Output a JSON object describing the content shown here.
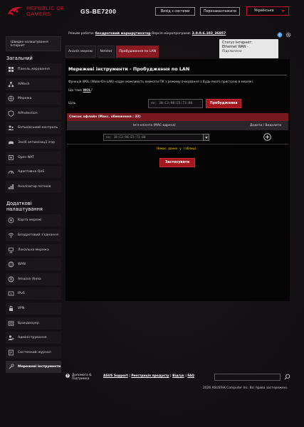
{
  "header": {
    "brand_line1": "REPUBLIC OF",
    "brand_line2": "GAMERS",
    "model": "GS-BE7200",
    "logout_label": "Вихід з системи",
    "reboot_label": "Перезавантажити",
    "language": "Українська"
  },
  "status_bar": {
    "opmode_label": "Режим роботи:",
    "opmode_value": "бездротовий маршрутизатор",
    "firmware_label": "Версія мікропрограми:",
    "firmware_value": "3.0.0.6.102_36857"
  },
  "tooltip": {
    "line1": "Статус Інтернет:",
    "line2": "Ethernet WAN -",
    "line3": "Підключено"
  },
  "sidebar": {
    "quick_setup": "Швидке налаштування Інтернет",
    "general_title": "Загальний",
    "general_items": [
      {
        "label": "Панель керування",
        "icon": "dashboard-icon"
      },
      {
        "label": "AiMesh",
        "icon": "aimesh-icon"
      },
      {
        "label": "Мережа",
        "icon": "network-icon"
      },
      {
        "label": "AiProtection",
        "icon": "aiprotection-icon"
      },
      {
        "label": "Батьківський контроль",
        "icon": "parental-control-icon"
      },
      {
        "label": "Засіб оптимізації ігор",
        "icon": "game-booster-icon"
      },
      {
        "label": "Open NAT",
        "icon": "open-nat-icon"
      },
      {
        "label": "Адаптивна QoS",
        "icon": "qos-icon"
      },
      {
        "label": "Аналізатор потоків",
        "icon": "traffic-analyzer-icon"
      }
    ],
    "advanced_title": "Додаткові налаштування",
    "advanced_items": [
      {
        "label": "Карта мережі",
        "icon": "network-map-icon"
      },
      {
        "label": "Бездротовий з'єднання",
        "icon": "wireless-icon"
      },
      {
        "label": "Локальна мережа",
        "icon": "lan-icon"
      },
      {
        "label": "WAN",
        "icon": "wan-icon"
      },
      {
        "label": "Amazon Alexa",
        "icon": "alexa-icon"
      },
      {
        "label": "IPv6",
        "icon": "ipv6-icon"
      },
      {
        "label": "VPN",
        "icon": "vpn-icon"
      },
      {
        "label": "Брандмауер",
        "icon": "firewall-icon"
      },
      {
        "label": "Адміністрування",
        "icon": "administration-icon"
      },
      {
        "label": "Системний журнал",
        "icon": "system-log-icon"
      },
      {
        "label": "Мережеві інструменти",
        "icon": "network-tools-icon"
      }
    ]
  },
  "tabs": [
    {
      "label": "Аналіз мережі"
    },
    {
      "label": "Netstat"
    },
    {
      "label": "Пробудження по LAN"
    }
  ],
  "main": {
    "title": "Мережеві інструменти - Пробудження по LAN",
    "description": "Функція WOL (Wake-On-LAN) надає можливість вмикати ПК з режиму очікування з будь-якого пристрою в мережі.",
    "what_is_prefix": "Що таке ",
    "what_is_link": "WOL",
    "what_is_suffix": "?",
    "target_label": "Ціль",
    "target_placeholder": "ex: 30:C3:98:E5:73:00",
    "wake_button": "Пробудження",
    "offline_header": "Список офлайн (Макс. обмеження : 32)",
    "col_client_name": "Ім'я клієнта (MAC-адреса)",
    "col_add_delete": "Додати / Видалити",
    "row_placeholder": "ex: 30:C3:98:E5:73:00",
    "no_data": "Немає даних у таблиці.",
    "apply_button": "Застосувати"
  },
  "footer": {
    "help_line1": "Допомога &",
    "help_line2": "Підтримка",
    "link_support": "ASUS Support",
    "link_registration": "Реєстрація продукту",
    "link_feedback": "Відгук",
    "link_faq": "FAQ",
    "copyright": "2026 ASUSTeK Computer Inc. Всі права застережені."
  },
  "colors": {
    "accent_red": "#a4171f",
    "brand_red": "#c8102e",
    "warning_yellow": "#e6c800"
  }
}
